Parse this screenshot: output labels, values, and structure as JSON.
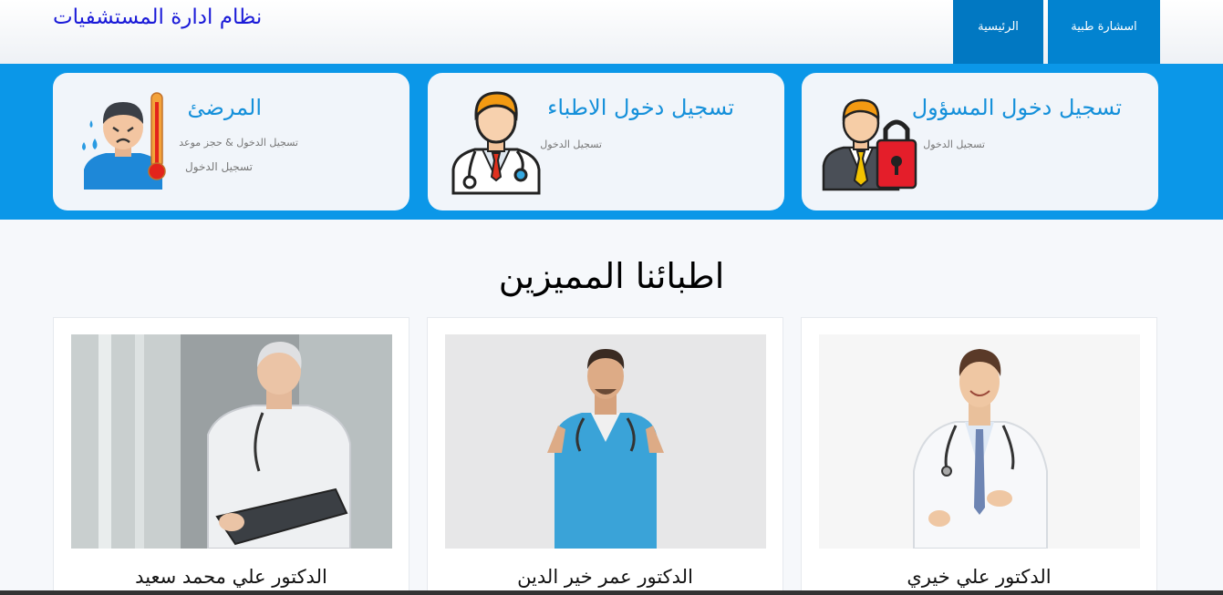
{
  "header": {
    "brand": "نظام ادارة المستشفيات",
    "nav": {
      "home": "الرئيسية",
      "consult": "اسشارة طبية"
    }
  },
  "cards": {
    "admin": {
      "title": "تسجيل دخول المسؤول",
      "login": "تسجيل الدخول",
      "icon": "admin-lock-icon"
    },
    "doctor": {
      "title": "تسجيل دخول الاطباء",
      "login": "تسجيل الدخول",
      "icon": "doctor-icon"
    },
    "patient": {
      "title": "المرضئ",
      "book": "تسجيل الدخول & حجز موعد",
      "login": "تسجيل الدخول",
      "icon": "sick-patient-icon"
    }
  },
  "section": {
    "title": "اطبائنا المميزين"
  },
  "doctors": [
    {
      "name": "الدكتور علي خيري"
    },
    {
      "name": "الدكتور عمر خير الدين"
    },
    {
      "name": "الدكتور علي محمد سعيد"
    }
  ],
  "colors": {
    "band": "#0b97e8",
    "nav": "#0283d0",
    "accent": "#1590da",
    "brand": "#1a1ad8"
  }
}
